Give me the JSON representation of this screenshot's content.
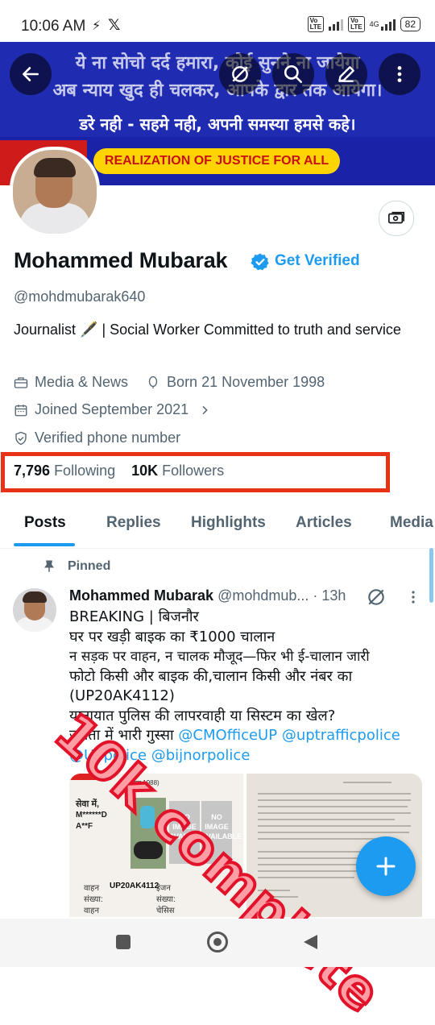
{
  "status_bar": {
    "time": "10:06 AM",
    "network": "4G",
    "battery": "82"
  },
  "banner": {
    "line1": "ये ना सोचो दर्द हमारा, कोई सुनने ना जायेगा",
    "line2": "अब न्याय खुद ही चलकर, आपके द्वार तक आयेगा।",
    "line3": "डरे नही - सहमे नही, अपनी समस्या हमसे कहे।",
    "tagline": "REALIZATION OF JUSTICE FOR ALL"
  },
  "profile": {
    "name": "Mohammed Mubarak",
    "get_verified": "Get Verified",
    "handle": "@mohdmubarak640",
    "bio": "Journalist 🖋️ | Social Worker Committed to truth and service",
    "category": "Media & News",
    "born": "Born 21 November 1998",
    "joined": "Joined September 2021",
    "verified_phone": "Verified phone number",
    "following_count": "7,796",
    "following_label": "Following",
    "followers_count": "10K",
    "followers_label": "Followers"
  },
  "tabs": [
    "Posts",
    "Replies",
    "Highlights",
    "Articles",
    "Media"
  ],
  "pinned_label": "Pinned",
  "tweet": {
    "author": "Mohammed Mubarak",
    "handle_time": "@mohdmub... · 13h",
    "lines": [
      "BREAKING | बिजनौर",
      "घर पर खड़ी बाइक का ₹1000 चालान",
      "न सड़क पर वाहन, न चालक मौजूद—फिर भी ई-चालान जारी",
      "फोटो किसी और बाइक की,चालान किसी और नंबर का",
      "(UP20AK4112)",
      "यातायात पुलिस की लापरवाही या सिस्टम का खेल?",
      "जनता में भारी गुस्सा"
    ],
    "mentions_line1": "@CMOfficeUP @uptrafficpolice",
    "mentions_line2": "@Uppolice @bijnorpolice",
    "image1": {
      "act": "अधिनियम 1988)",
      "to": "सेवा में,",
      "to_name1": "M******D",
      "to_name2": "A**F",
      "no_image": "NO IMAGE AVAILABLE",
      "vehicle_label": "वाहन",
      "vehicle_no": "UP20AK4112",
      "engine_label": "इंजन",
      "number_label": "संख्या:",
      "chassis_label": "चेसिस"
    }
  },
  "overlay_text": "10k complete",
  "colors": {
    "accent": "#1d9bf0",
    "highlight_box": "#e83218",
    "banner_bg": "#1f2bb0",
    "tagline_bg": "#ffd400"
  }
}
